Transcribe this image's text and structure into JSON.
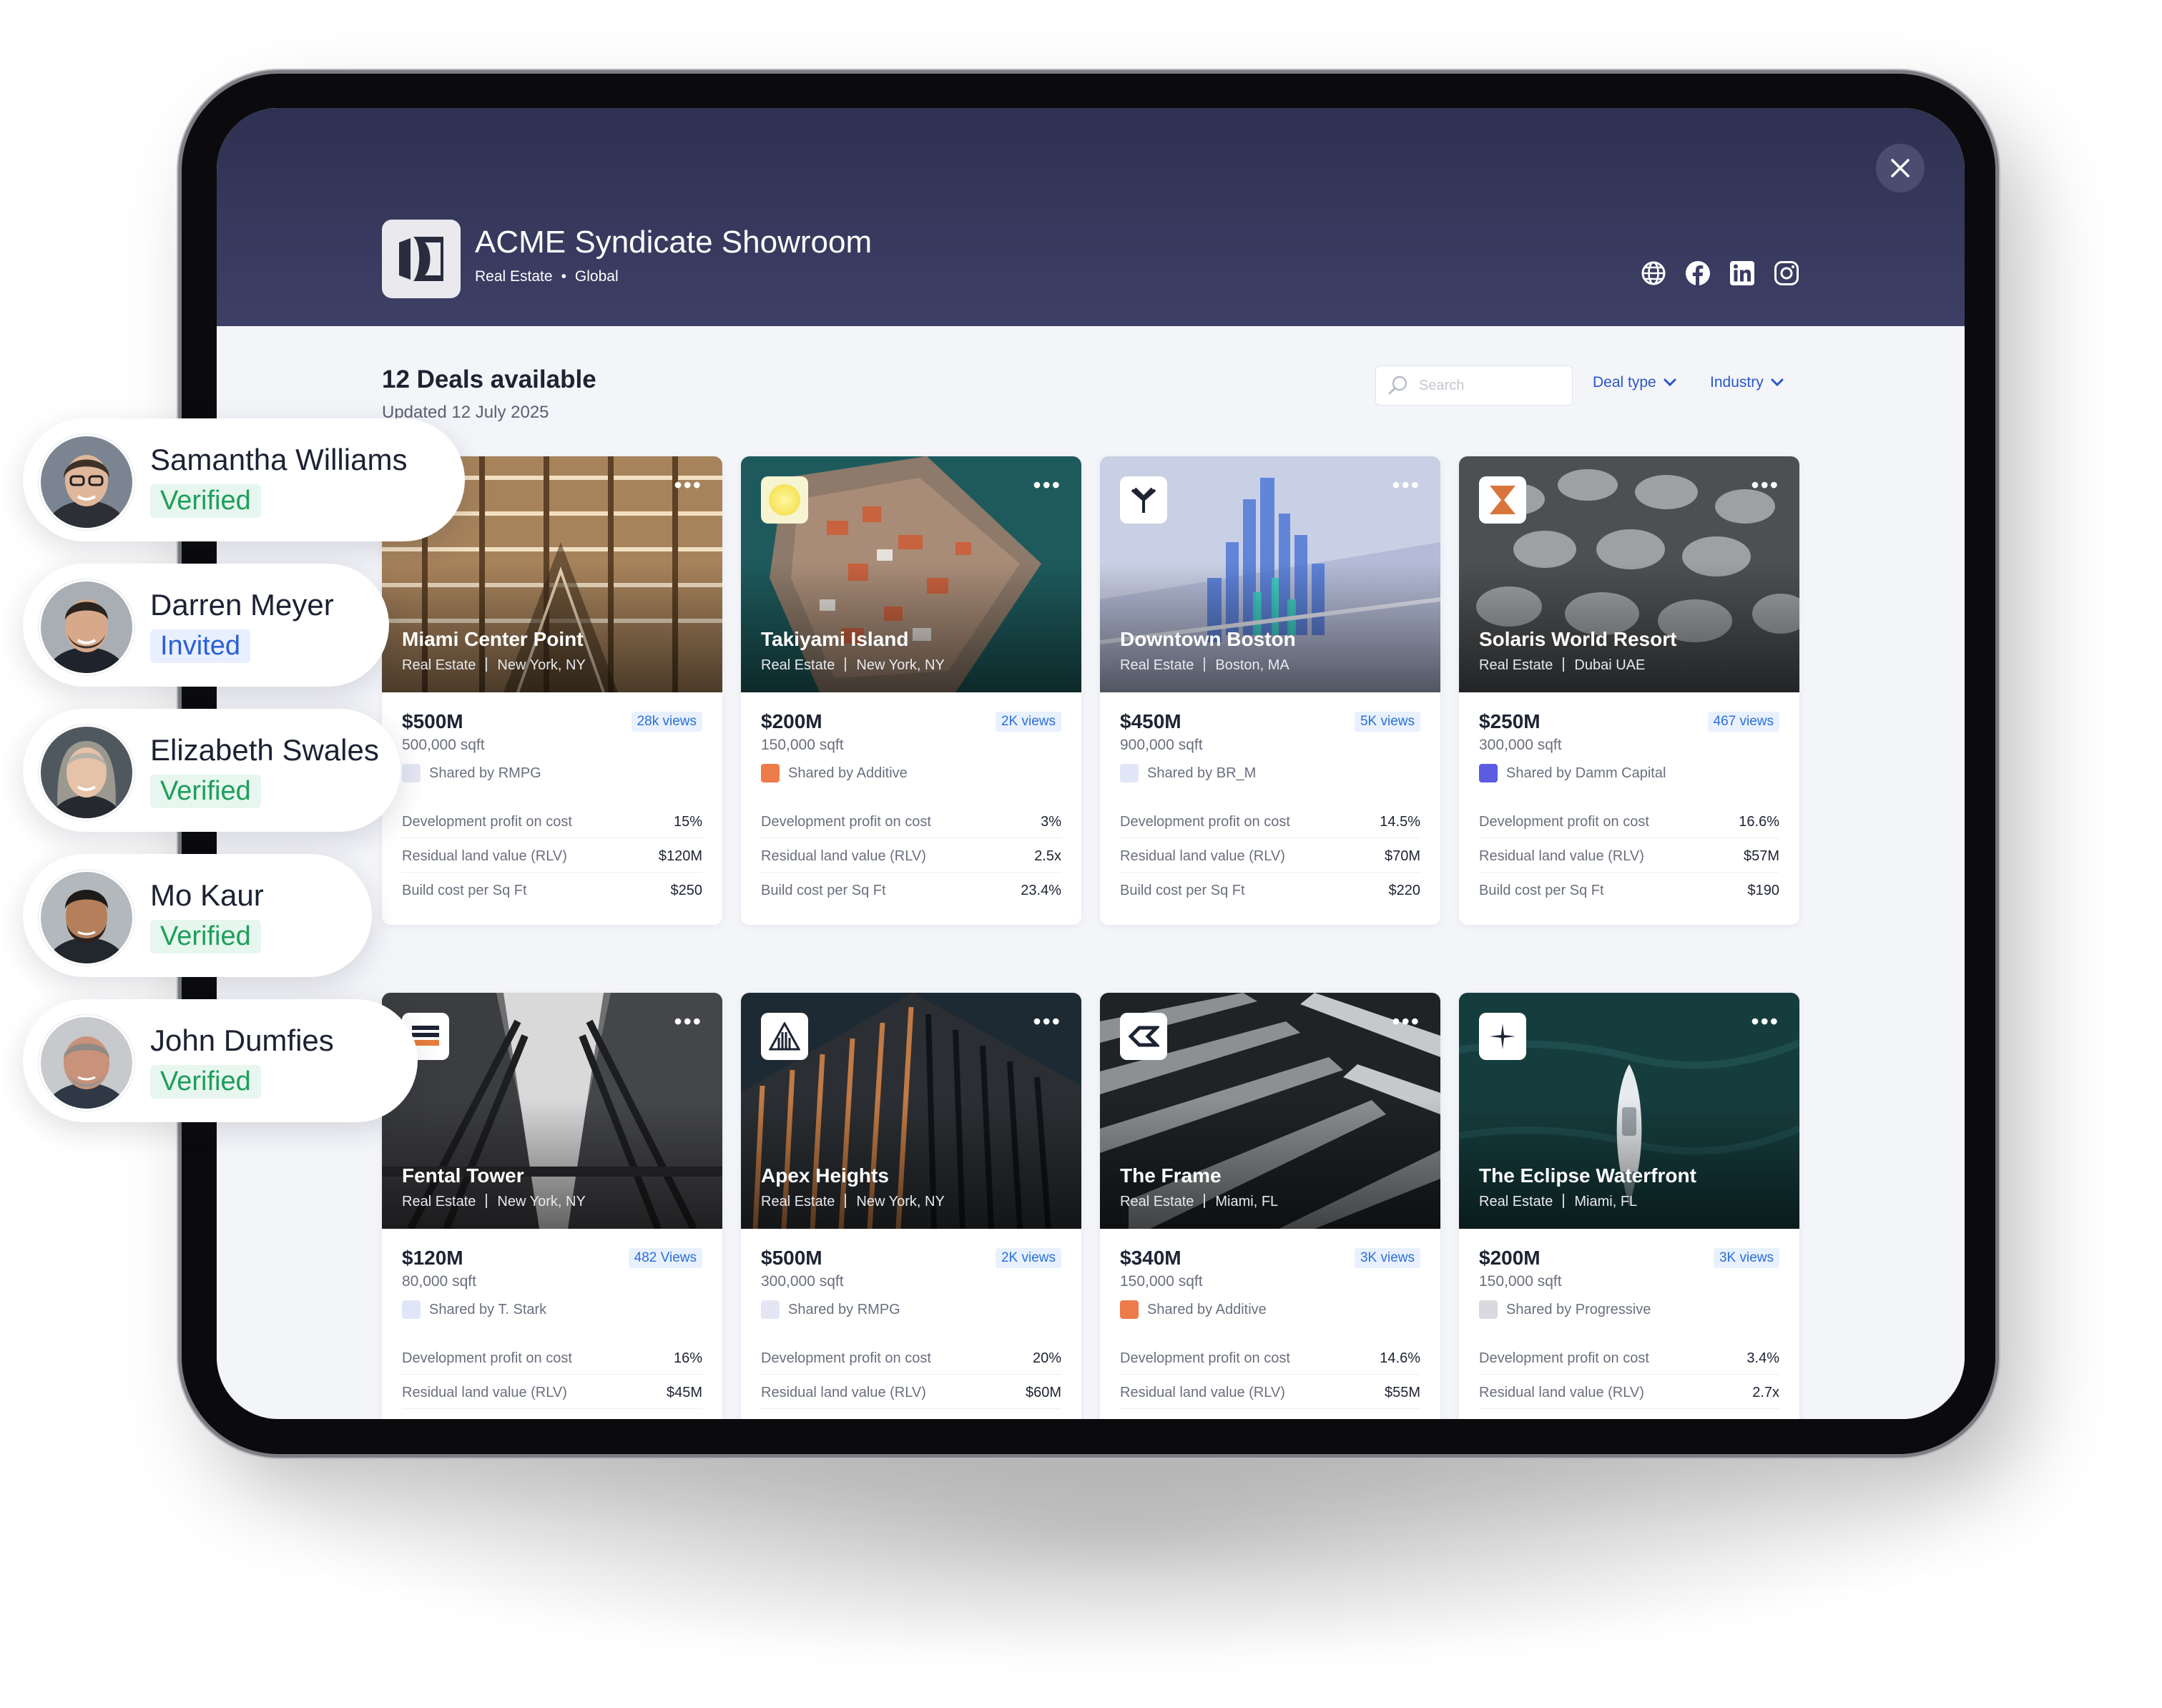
{
  "app": {
    "title": "ACME Syndicate Showroom",
    "category": "Real Estate",
    "region": "Global",
    "separator": "•"
  },
  "socials": [
    "globe-icon",
    "facebook-icon",
    "linkedin-icon",
    "instagram-icon"
  ],
  "toolbar": {
    "deals_title": "12 Deals available",
    "updated": "Updated 12 July 2025",
    "search_placeholder": "Search",
    "deal_type_label": "Deal type",
    "industry_label": "Industry"
  },
  "metric_labels": {
    "dev_profit": "Development profit on cost",
    "rlv": "Residual land value (RLV)",
    "build_cost": "Build cost per Sq Ft"
  },
  "deals": [
    {
      "name": "Miami Center Point",
      "category": "Real Estate",
      "location": "New York, NY",
      "price": "$500M",
      "views": "28k views",
      "sqft": "500,000 sqft",
      "shared_by": "Shared by RMPG",
      "dev_profit": "15%",
      "rlv": "$120M",
      "build_cost": "$250"
    },
    {
      "name": "Takiyami Island",
      "category": "Real Estate",
      "location": "New York, NY",
      "price": "$200M",
      "views": "2K views",
      "sqft": "150,000 sqft",
      "shared_by": "Shared by Additive",
      "dev_profit": "3%",
      "rlv": "2.5x",
      "build_cost": "23.4%"
    },
    {
      "name": "Downtown Boston",
      "category": "Real Estate",
      "location": "Boston, MA",
      "price": "$450M",
      "views": "5K views",
      "sqft": "900,000 sqft",
      "shared_by": "Shared by BR_M",
      "dev_profit": "14.5%",
      "rlv": "$70M",
      "build_cost": "$220"
    },
    {
      "name": "Solaris World Resort",
      "category": "Real Estate",
      "location": "Dubai UAE",
      "price": "$250M",
      "views": "467 views",
      "sqft": "300,000 sqft",
      "shared_by": "Shared by Damm Capital",
      "dev_profit": "16.6%",
      "rlv": "$57M",
      "build_cost": "$190"
    },
    {
      "name": "Fental Tower",
      "category": "Real Estate",
      "location": "New York, NY",
      "price": "$120M",
      "views": "482 Views",
      "sqft": "80,000 sqft",
      "shared_by": "Shared by T. Stark",
      "dev_profit": "16%",
      "rlv": "$45M",
      "build_cost": ""
    },
    {
      "name": "Apex Heights",
      "category": "Real Estate",
      "location": "New York, NY",
      "price": "$500M",
      "views": "2K views",
      "sqft": "300,000 sqft",
      "shared_by": "Shared by RMPG",
      "dev_profit": "20%",
      "rlv": "$60M",
      "build_cost": ""
    },
    {
      "name": "The Frame",
      "category": "Real Estate",
      "location": "Miami, FL",
      "price": "$340M",
      "views": "3K views",
      "sqft": "150,000 sqft",
      "shared_by": "Shared by Additive",
      "dev_profit": "14.6%",
      "rlv": "$55M",
      "build_cost": ""
    },
    {
      "name": "The Eclipse Waterfront",
      "category": "Real Estate",
      "location": "Miami, FL",
      "price": "$200M",
      "views": "3K views",
      "sqft": "150,000 sqft",
      "shared_by": "Shared by Progressive",
      "dev_profit": "3.4%",
      "rlv": "2.7x",
      "build_cost": ""
    }
  ],
  "users": [
    {
      "name": "Samantha Williams",
      "status": "Verified"
    },
    {
      "name": "Darren Meyer",
      "status": "Invited"
    },
    {
      "name": "Elizabeth Swales",
      "status": "Verified"
    },
    {
      "name": "Mo Kaur",
      "status": "Verified"
    },
    {
      "name": "John Dumfies",
      "status": "Verified"
    }
  ],
  "colors": {
    "header_top": "#2f3152",
    "header_bottom": "#3d3f66",
    "accent_blue": "#2b55c8",
    "verified_green": "#1d9e5a",
    "invited_blue": "#2a60d6",
    "screen_bg": "#f4f5f9"
  },
  "card_menu_glyph": "•••",
  "close_glyph": "✕"
}
